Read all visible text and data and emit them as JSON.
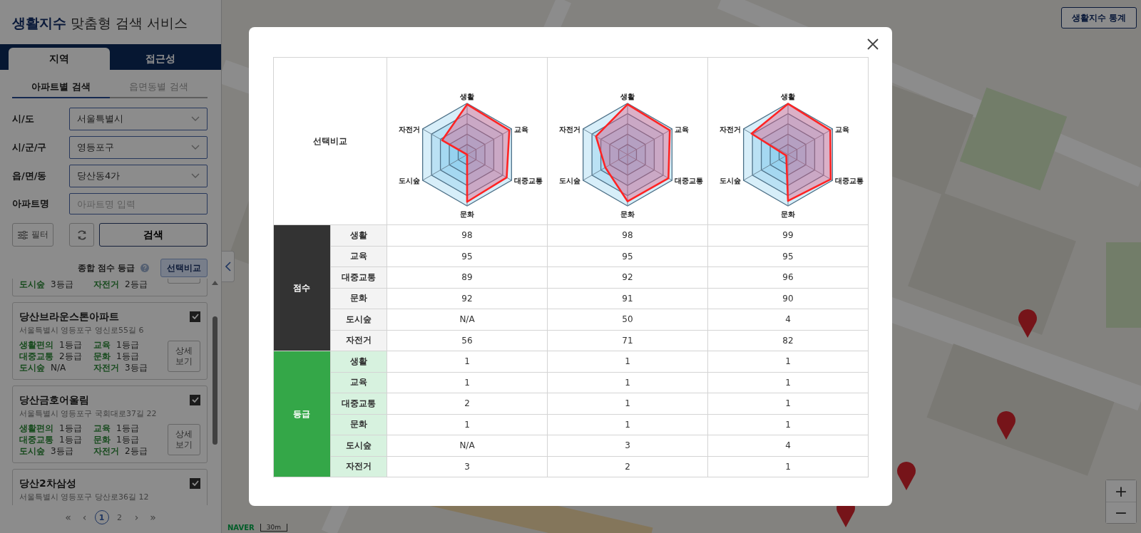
{
  "header": {
    "title": "**생활지수** 맞춤형 검색 서비스"
  },
  "main_tabs": [
    {
      "label": "지역",
      "selected": true
    },
    {
      "label": "접근성",
      "selected": false
    }
  ],
  "sub_tabs": [
    {
      "label": "아파트별 검색",
      "selected": true
    },
    {
      "label": "읍면동별 검색",
      "selected": false
    }
  ],
  "form": [
    {
      "kind": "select",
      "label": "시/도",
      "value": "서울특별시"
    },
    {
      "kind": "select",
      "label": "시/군/구",
      "value": "영등포구"
    },
    {
      "kind": "select",
      "label": "읍/면/동",
      "value": "당산동4가"
    },
    {
      "kind": "input",
      "label": "아파트명",
      "placeholder": "아파트명 입력"
    }
  ],
  "buttons": {
    "filter": "필터",
    "search": "검색"
  },
  "summary": {
    "label": "종합 점수 등급",
    "compare_button": "선택비교"
  },
  "results": [
    {
      "partial": true,
      "grades": [
        {
          "label": "도시숲",
          "value": "3등급"
        },
        {
          "label": "자전거",
          "value": "2등급"
        }
      ]
    },
    {
      "partial": false,
      "name": "당산브라운스톤아파트",
      "address": "서울특별시 영등포구 영신로55길 6",
      "checked": true,
      "detail_button": "상세 보기",
      "grades": [
        {
          "label": "생활편의",
          "value": "1등급"
        },
        {
          "label": "교육",
          "value": "1등급"
        },
        {
          "label": "대중교통",
          "value": "2등급"
        },
        {
          "label": "문화",
          "value": "1등급"
        },
        {
          "label": "도시숲",
          "value": "N/A"
        },
        {
          "label": "자전거",
          "value": "3등급"
        }
      ]
    },
    {
      "partial": false,
      "name": "당산금호어울림",
      "address": "서울특별시 영등포구 국회대로37길 22",
      "checked": true,
      "detail_button": "상세 보기",
      "grades": [
        {
          "label": "생활편의",
          "value": "1등급"
        },
        {
          "label": "교육",
          "value": "1등급"
        },
        {
          "label": "대중교통",
          "value": "1등급"
        },
        {
          "label": "문화",
          "value": "1등급"
        },
        {
          "label": "도시숲",
          "value": "3등급"
        },
        {
          "label": "자전거",
          "value": "2등급"
        }
      ]
    },
    {
      "partial": false,
      "name": "당산2차삼성",
      "address": "서울특별시 영등포구 당산로36길 12",
      "checked": true
    }
  ],
  "pagination": {
    "first": "«",
    "prev": "‹",
    "pages": [
      {
        "label": "1",
        "selected": true
      },
      {
        "label": "2",
        "selected": false
      }
    ],
    "next": "›",
    "last": "»"
  },
  "map": {
    "kind": "picture",
    "stats_button": "생활지수 통계",
    "zoom_in": "+",
    "zoom_out": "−",
    "logo": "NAVER",
    "scale": "30m"
  },
  "comparison": {
    "header_label": "선택비교",
    "apartments": [
      {
        "axis_labels": [
          "생활",
          "교육",
          "대중교통",
          "문화",
          "도시숲",
          "자전거"
        ]
      },
      {
        "axis_labels": [
          "생활",
          "교육",
          "대중교통",
          "문화",
          "도시숲",
          "자전거"
        ]
      },
      {
        "axis_labels": [
          "생활",
          "교육",
          "대중교통",
          "문화",
          "도시숲",
          "자전거"
        ]
      }
    ],
    "groups": [
      {
        "kind": "score",
        "label": "점수",
        "rows": [
          {
            "label": "생활",
            "values": [
              "98",
              "98",
              "99"
            ]
          },
          {
            "label": "교육",
            "values": [
              "95",
              "95",
              "95"
            ]
          },
          {
            "label": "대중교통",
            "values": [
              "89",
              "92",
              "96"
            ]
          },
          {
            "label": "문화",
            "values": [
              "92",
              "91",
              "90"
            ]
          },
          {
            "label": "도시숲",
            "values": [
              "N/A",
              "50",
              "4"
            ]
          },
          {
            "label": "자전거",
            "values": [
              "56",
              "71",
              "82"
            ]
          }
        ]
      },
      {
        "kind": "grade",
        "label": "등급",
        "rows": [
          {
            "label": "생활",
            "values": [
              "1",
              "1",
              "1"
            ]
          },
          {
            "label": "교육",
            "values": [
              "1",
              "1",
              "1"
            ]
          },
          {
            "label": "대중교통",
            "values": [
              "2",
              "1",
              "1"
            ]
          },
          {
            "label": "문화",
            "values": [
              "1",
              "1",
              "1"
            ]
          },
          {
            "label": "도시숲",
            "values": [
              "N/A",
              "3",
              "4"
            ]
          },
          {
            "label": "자전거",
            "values": [
              "3",
              "2",
              "1"
            ]
          }
        ]
      }
    ]
  }
}
